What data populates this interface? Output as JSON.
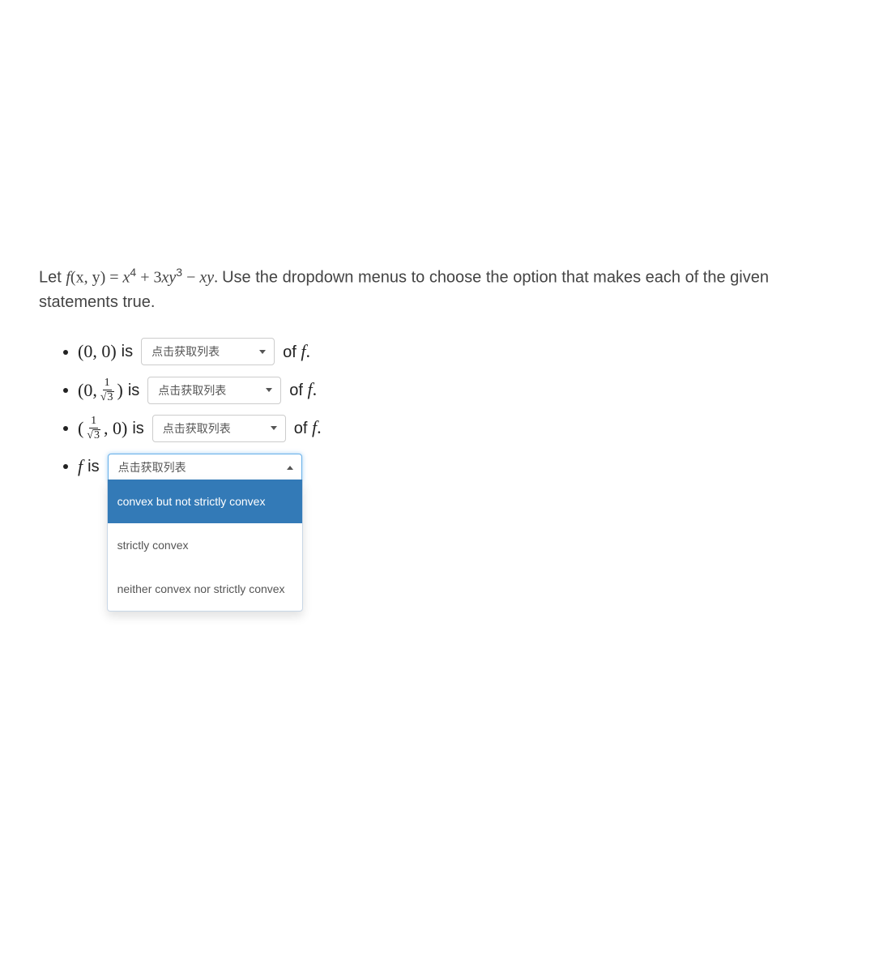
{
  "prompt": {
    "pre": "Let ",
    "func_lhs_a": "f",
    "func_lhs_b": "(x, y) = ",
    "expr_x4": "x",
    "sup4": "4",
    "plus": " + 3",
    "xy": "xy",
    "sup3": "3",
    "minus": " − ",
    "xy2": "xy",
    "period": ". ",
    "post": "Use the dropdown menus to choose the option that makes each of the given statements true."
  },
  "dropdown_placeholder": "点击获取列表",
  "items": {
    "p00": {
      "open": "(0, 0)",
      "is": " is",
      "after_of": "of ",
      "after_f": "f",
      "after_dot": "."
    },
    "p0r3": {
      "open_a": "(0, ",
      "close": ")",
      "is": " is",
      "frac_num": "1",
      "frac_den": "3",
      "after_of": "of ",
      "after_f": "f",
      "after_dot": "."
    },
    "pr30": {
      "open_a": "(",
      "mid": ", 0)",
      "is": " is",
      "frac_num": "1",
      "frac_den": "3",
      "after_of": "of ",
      "after_f": "f",
      "after_dot": "."
    },
    "fis": {
      "f": "f",
      "is": " is"
    }
  },
  "dropdown_options": [
    "convex but not strictly convex",
    "strictly convex",
    "neither convex nor strictly convex"
  ]
}
